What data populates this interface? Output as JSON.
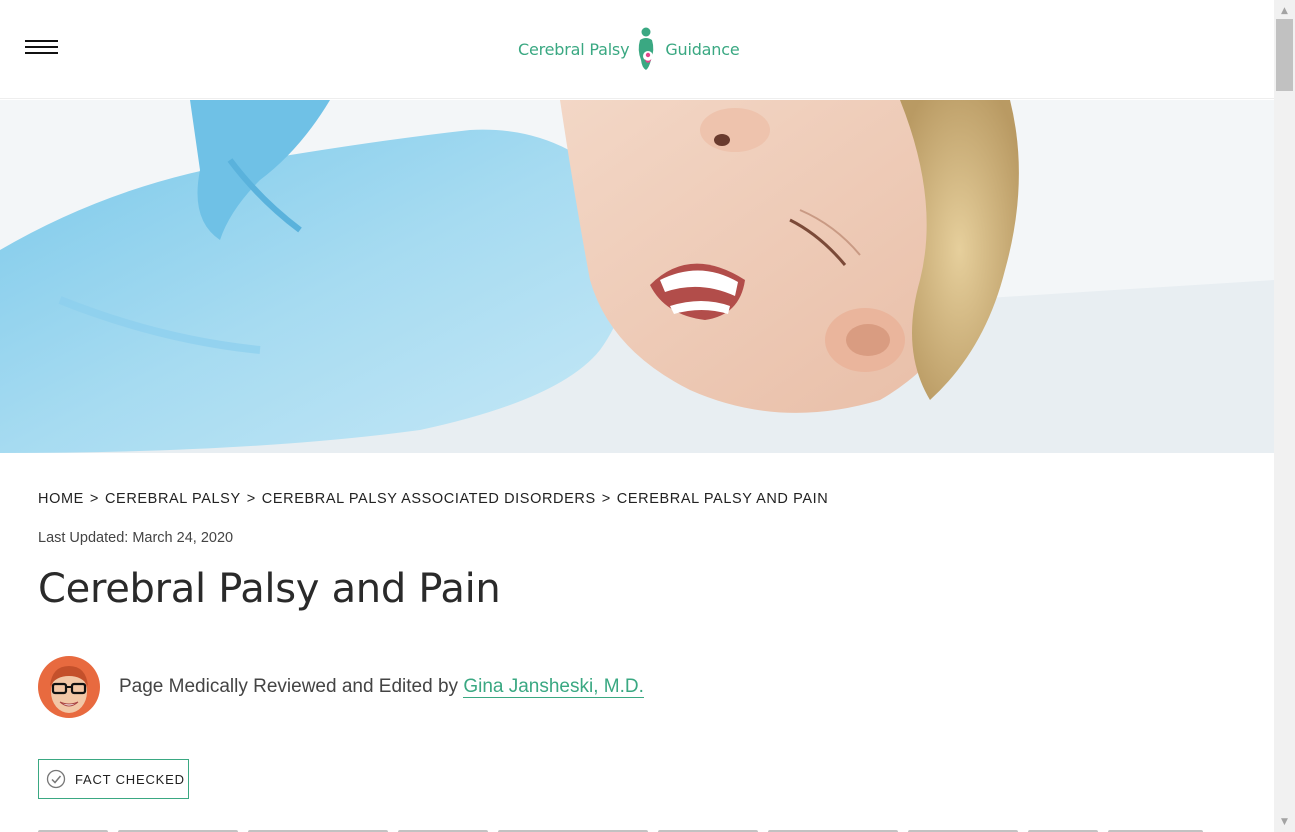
{
  "header": {
    "menu_icon": "hamburger-menu-icon",
    "logo": {
      "text_left": "Cerebral Palsy",
      "text_right": "Guidance",
      "icon": "figure-logo-icon",
      "brand_color": "#3aa882",
      "accent_color": "#e0458a"
    }
  },
  "hero": {
    "description_icon": "hero-photo"
  },
  "breadcrumb": [
    {
      "label": "HOME"
    },
    {
      "label": "CEREBRAL PALSY"
    },
    {
      "label": "CEREBRAL PALSY ASSOCIATED DISORDERS"
    },
    {
      "label": "CEREBRAL PALSY AND PAIN"
    }
  ],
  "breadcrumb_separator": ">",
  "updated": {
    "label": "Last Updated:",
    "date": "March 24, 2020"
  },
  "page_title": "Cerebral Palsy and Pain",
  "reviewer": {
    "text": "Page Medically Reviewed and Edited by",
    "name": "Gina Jansheski, M.D."
  },
  "fact_badge": {
    "label": "FACT CHECKED",
    "icon": "check-circle-icon",
    "color": "#3aa882"
  },
  "scrollbar": {
    "up_icon": "scroll-up-arrow-icon",
    "down_icon": "scroll-down-arrow-icon"
  }
}
